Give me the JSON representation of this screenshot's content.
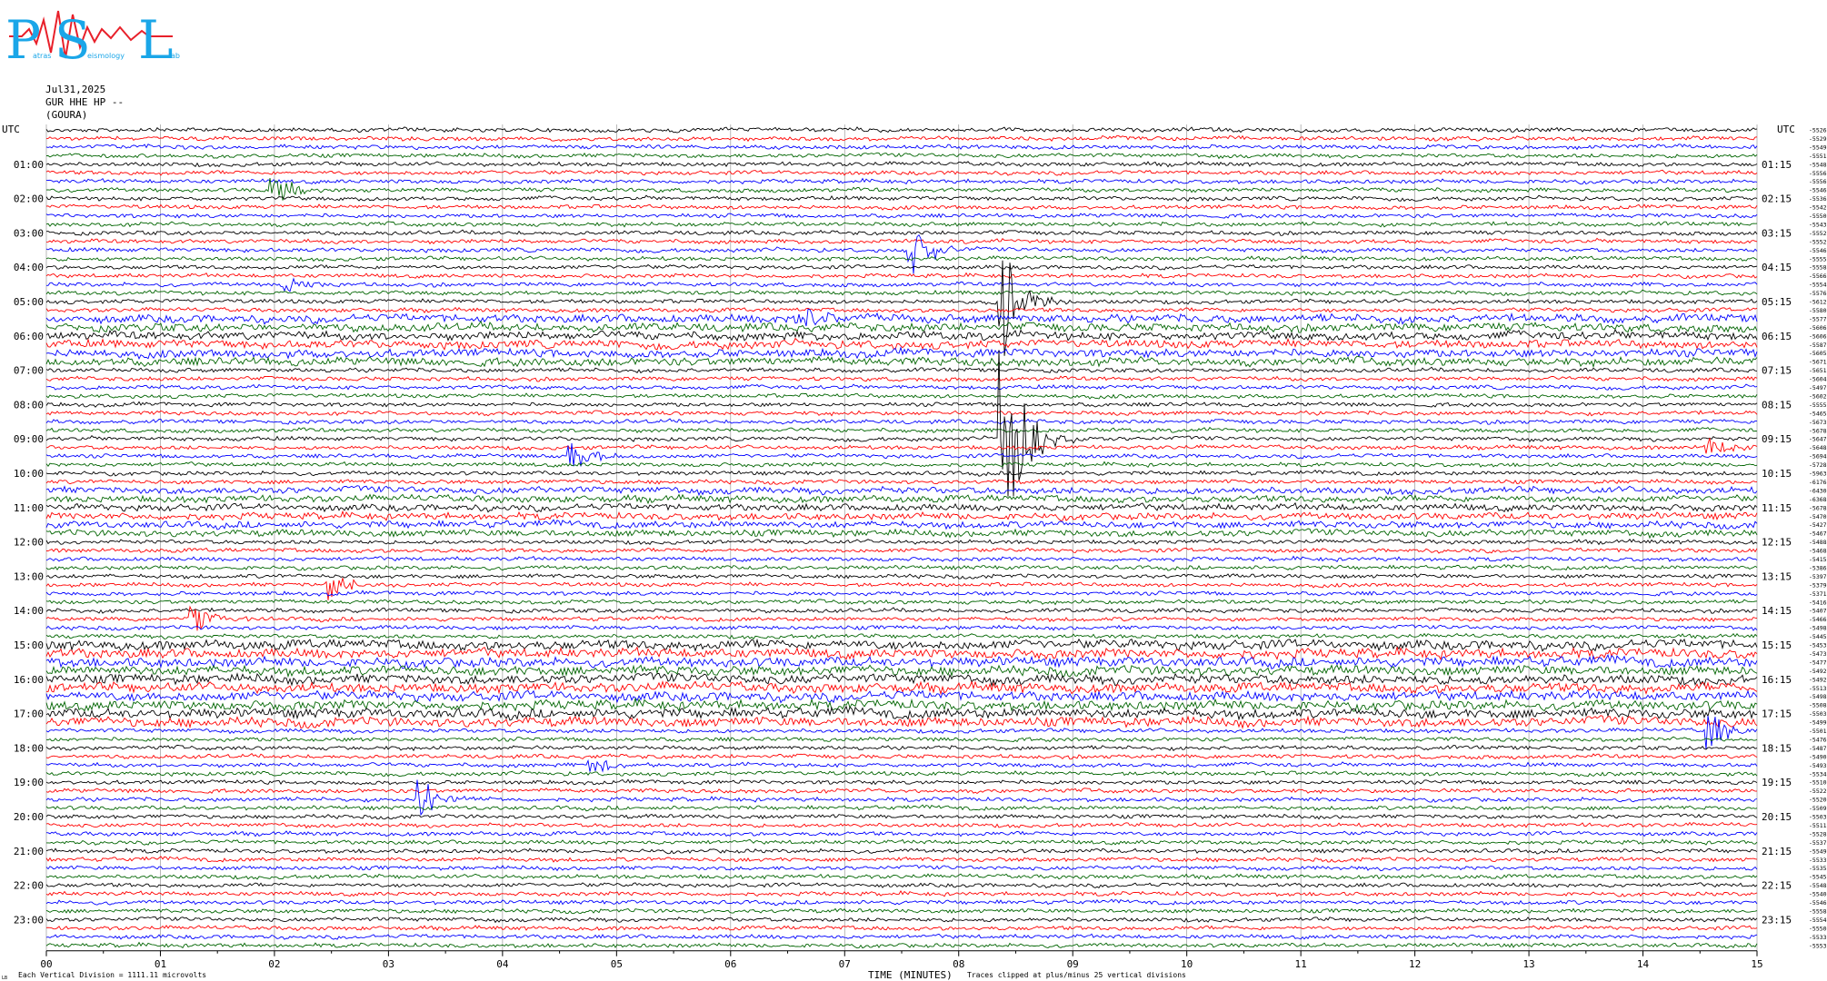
{
  "logo": {
    "letters": [
      "P",
      "S",
      "L"
    ],
    "small_words": [
      "atras",
      "eismology",
      "ab"
    ],
    "color_main": "#1aa6e8",
    "color_wave": "#e8202a"
  },
  "header": {
    "date": "Jul31,2025",
    "station": "GUR HHE HP --",
    "site": "(GOURA)"
  },
  "chart_data": {
    "type": "line",
    "title": "",
    "left_axis_label": "UTC",
    "right_axis_label": "UTC",
    "xlabel": "TIME (MINUTES)",
    "x_ticks": [
      "00",
      "01",
      "02",
      "03",
      "04",
      "05",
      "06",
      "07",
      "08",
      "09",
      "10",
      "11",
      "12",
      "13",
      "14",
      "15"
    ],
    "xlim": [
      0,
      15
    ],
    "hour_labels_left": [
      "01:00",
      "02:00",
      "03:00",
      "04:00",
      "05:00",
      "06:00",
      "07:00",
      "08:00",
      "09:00",
      "10:00",
      "11:00",
      "12:00",
      "13:00",
      "14:00",
      "15:00",
      "16:00",
      "17:00",
      "18:00",
      "19:00",
      "20:00",
      "21:00",
      "22:00",
      "23:00"
    ],
    "hour_labels_right": [
      "01:15",
      "02:15",
      "03:15",
      "04:15",
      "05:15",
      "06:15",
      "07:15",
      "08:15",
      "09:15",
      "10:15",
      "11:15",
      "12:15",
      "13:15",
      "14:15",
      "15:15",
      "16:15",
      "17:15",
      "18:15",
      "19:15",
      "20:15",
      "21:15",
      "22:15",
      "23:15"
    ],
    "trace_colors": [
      "#000000",
      "#ff0000",
      "#0000ff",
      "#006400"
    ],
    "trace_count": 96,
    "grid": "vertical lines each minute",
    "right_values": [
      "-5526",
      "-5529",
      "-5549",
      "-5551",
      "-5548",
      "-5556",
      "-5556",
      "-5546",
      "-5536",
      "-5542",
      "-5550",
      "-5543",
      "-5552",
      "-5552",
      "-5546",
      "-5555",
      "-5558",
      "-5566",
      "-5554",
      "-5576",
      "-5612",
      "-5580",
      "-5577",
      "-5606",
      "-5606",
      "-5587",
      "-5605",
      "-5671",
      "-5651",
      "-5604",
      "-5497",
      "-5602",
      "-5555",
      "-5465",
      "-5673",
      "-5678",
      "-5647",
      "-5648",
      "-5694",
      "-5728",
      "-5963",
      "-6176",
      "-6430",
      "-6368",
      "-5678",
      "-5470",
      "-5427",
      "-5467",
      "-5488",
      "-5468",
      "-5415",
      "-5386",
      "-5397",
      "-5379",
      "-5371",
      "-5416",
      "-5407",
      "-5466",
      "-5498",
      "-5445",
      "-5453",
      "-5473",
      "-5477",
      "-5492",
      "-5492",
      "-5513",
      "-5498",
      "-5508",
      "-5503",
      "-5499",
      "-5501",
      "-5476",
      "-5487",
      "-5490",
      "-5493",
      "-5534",
      "-5510",
      "-5522",
      "-5520",
      "-5509",
      "-5503",
      "-5511",
      "-5528",
      "-5537",
      "-5549",
      "-5533",
      "-5535",
      "-5545",
      "-5548",
      "-5540",
      "-5546",
      "-5558",
      "-5554",
      "-5550",
      "-5533",
      "-5553"
    ],
    "events": [
      {
        "trace": 7,
        "minute": 2.0,
        "amp": 18,
        "color": "#0000ff"
      },
      {
        "trace": 14,
        "minute": 7.6,
        "amp": 28,
        "color": "#ff0000"
      },
      {
        "trace": 18,
        "minute": 2.1,
        "amp": 10,
        "color": "#0000ff"
      },
      {
        "trace": 20,
        "minute": 8.4,
        "amp": 60,
        "color": "#0000ff"
      },
      {
        "trace": 22,
        "minute": 6.6,
        "amp": 20,
        "color": "#006400"
      },
      {
        "trace": 36,
        "minute": 8.4,
        "amp": 120,
        "color": "#0000ff"
      },
      {
        "trace": 38,
        "minute": 4.6,
        "amp": 22,
        "color": "#000000"
      },
      {
        "trace": 37,
        "minute": 14.6,
        "amp": 14,
        "color": "#0000ff"
      },
      {
        "trace": 53,
        "minute": 2.5,
        "amp": 16,
        "color": "#ff0000"
      },
      {
        "trace": 57,
        "minute": 1.3,
        "amp": 14,
        "color": "#ff0000"
      },
      {
        "trace": 70,
        "minute": 14.6,
        "amp": 20,
        "color": "#ff0000"
      },
      {
        "trace": 78,
        "minute": 3.3,
        "amp": 24,
        "color": "#000000"
      },
      {
        "trace": 74,
        "minute": 4.8,
        "amp": 10,
        "color": "#0000ff"
      }
    ]
  },
  "footer": {
    "scale_note": "Each Vertical Division = 1111.11 microvolts",
    "clip_note": "Traces clipped at plus/minus 25 vertical divisions",
    "corner_mark": "LB"
  }
}
